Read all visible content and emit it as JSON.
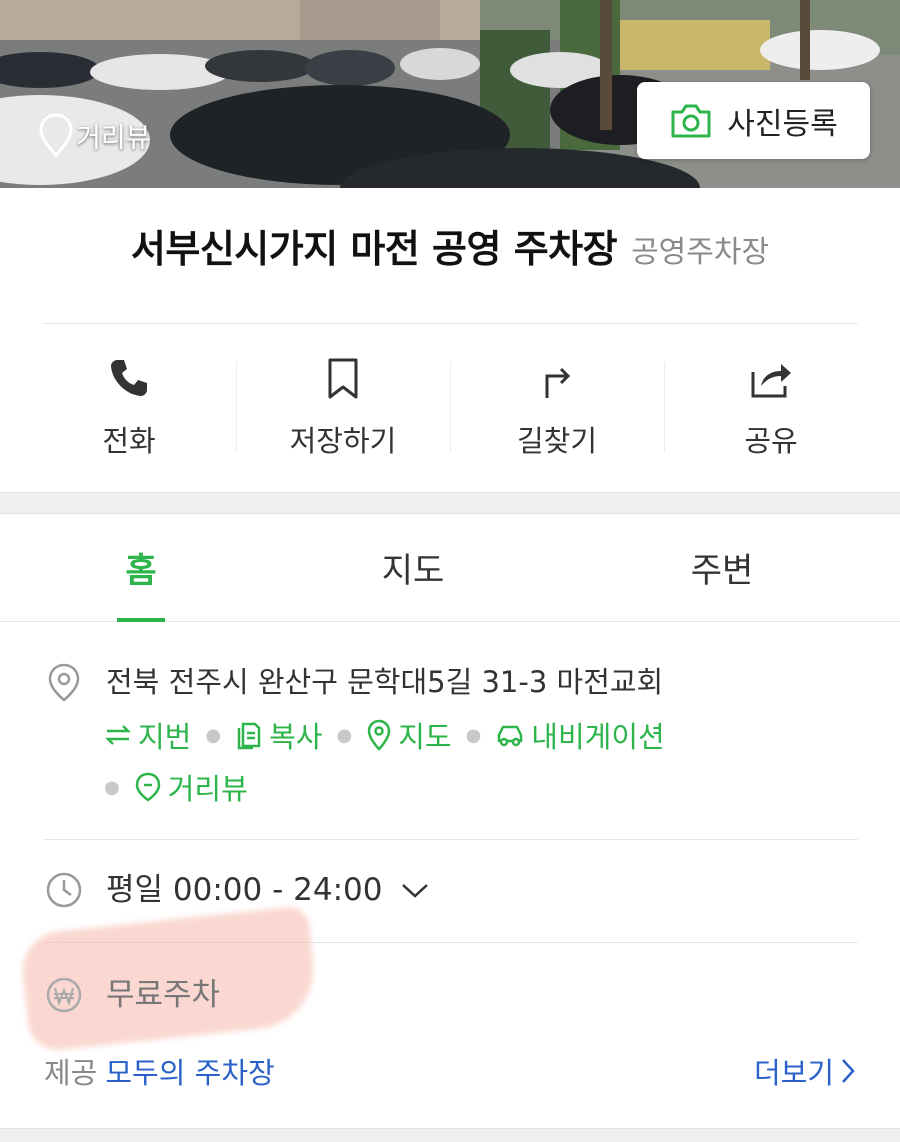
{
  "hero": {
    "roadview_label": "거리뷰",
    "photo_button_label": "사진등록"
  },
  "place": {
    "name": "서부신시가지 마전 공영 주차장",
    "category": "공영주차장"
  },
  "actions": [
    {
      "label": "전화",
      "icon": "phone-icon"
    },
    {
      "label": "저장하기",
      "icon": "bookmark-icon"
    },
    {
      "label": "길찾기",
      "icon": "directions-icon"
    },
    {
      "label": "공유",
      "icon": "share-icon"
    }
  ],
  "tabs": [
    {
      "label": "홈",
      "active": true
    },
    {
      "label": "지도",
      "active": false
    },
    {
      "label": "주변",
      "active": false
    }
  ],
  "address": {
    "text": "전북 전주시 완산구 문학대5길 31-3 마전교회",
    "links": [
      {
        "label": "지번",
        "icon": "swap-icon"
      },
      {
        "label": "복사",
        "icon": "copy-icon"
      },
      {
        "label": "지도",
        "icon": "map-pin-icon"
      },
      {
        "label": "내비게이션",
        "icon": "car-icon"
      },
      {
        "label": "거리뷰",
        "icon": "roadview-icon"
      }
    ]
  },
  "hours": {
    "text": "평일 00:00 - 24:00"
  },
  "price": {
    "text": "무료주차"
  },
  "footer": {
    "prefix": "제공",
    "provider": "모두의 주차장",
    "more": "더보기"
  },
  "colors": {
    "accent_green": "#2db44a",
    "link_blue": "#2a62c9",
    "highlight": "#f6b9ac"
  }
}
